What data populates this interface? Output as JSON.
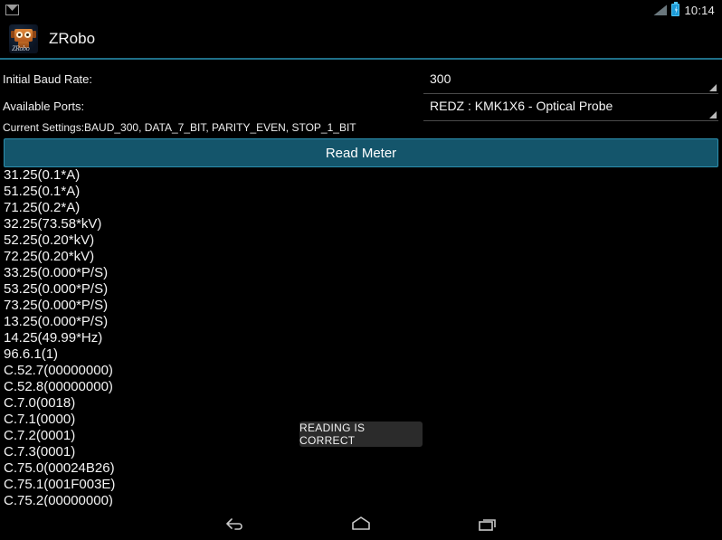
{
  "status_bar": {
    "notification_icon": "gmail-icon",
    "signal_icon": "signal-triangle-icon",
    "battery_icon": "battery-charging-icon",
    "clock": "10:14"
  },
  "action_bar": {
    "app_icon": "zrobo-app-icon",
    "icon_wordmark": "ZRobo",
    "title": "ZRobo",
    "divider_color": "#1f6f88"
  },
  "form": {
    "baud_label": "Initial Baud Rate:",
    "baud_value": "300",
    "ports_label": "Available Ports:",
    "ports_value": "REDZ : KMK1X6 - Optical  Probe",
    "current_settings": "Current Settings:BAUD_300, DATA_7_BIT, PARITY_EVEN, STOP_1_BIT"
  },
  "actions": {
    "read_meter_label": "Read Meter",
    "read_meter_color": "#14556b",
    "read_meter_border": "#2c8fae"
  },
  "readings": [
    "31.25(0.1*A)",
    "51.25(0.1*A)",
    "71.25(0.2*A)",
    "32.25(73.58*kV)",
    "52.25(0.20*kV)",
    "72.25(0.20*kV)",
    "33.25(0.000*P/S)",
    "53.25(0.000*P/S)",
    "73.25(0.000*P/S)",
    "13.25(0.000*P/S)",
    "14.25(49.99*Hz)",
    "96.6.1(1)",
    "C.52.7(00000000)",
    "C.52.8(00000000)",
    "C.7.0(0018)",
    "C.7.1(0000)",
    "C.7.2(0001)",
    "C.7.3(0001)",
    "C.75.0(00024B26)",
    "C.75.1(001F003E)",
    "C.75.2(00000000)"
  ],
  "toast": {
    "message": "READING IS CORRECT",
    "background": "#2b2b2b"
  },
  "nav_bar": {
    "back_icon": "back-arrow-icon",
    "home_icon": "home-icon",
    "recents_icon": "recents-icon"
  }
}
